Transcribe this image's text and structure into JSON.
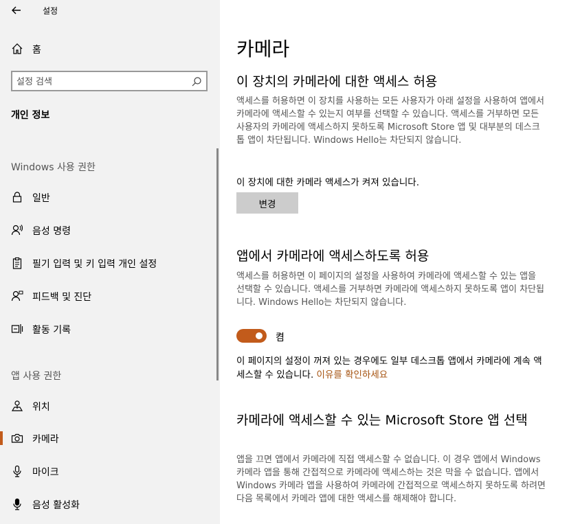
{
  "header": {
    "title": "설정",
    "back_icon": "back-arrow-icon"
  },
  "sidebar": {
    "home_label": "홈",
    "search_placeholder": "설정 검색",
    "section_title": "개인 정보",
    "groups": [
      {
        "title": "Windows 사용 권한",
        "items": [
          {
            "label": "일반",
            "icon": "lock-icon"
          },
          {
            "label": "음성 명령",
            "icon": "speech-icon"
          },
          {
            "label": "필기 입력 및 키 입력 개인 설정",
            "icon": "clipboard-icon"
          },
          {
            "label": "피드백 및 진단",
            "icon": "feedback-icon"
          },
          {
            "label": "활동 기록",
            "icon": "timeline-icon"
          }
        ]
      },
      {
        "title": "앱 사용 권한",
        "items": [
          {
            "label": "위치",
            "icon": "location-icon"
          },
          {
            "label": "카메라",
            "icon": "camera-icon",
            "selected": true
          },
          {
            "label": "마이크",
            "icon": "microphone-icon"
          },
          {
            "label": "음성 활성화",
            "icon": "voice-activation-icon"
          }
        ]
      }
    ]
  },
  "main": {
    "title": "카메라",
    "device_section": {
      "heading": "이 장치의 카메라에 대한 액세스 허용",
      "description": "액세스를 허용하면 이 장치를 사용하는 모든 사용자가 아래 설정을 사용하여 앱에서 카메라에 액세스할 수 있는지 여부를 선택할 수 있습니다. 액세스를 거부하면 모든 사용자의 카메라에 액세스하지 못하도록 Microsoft Store 앱 및 대부분의 데스크톱 앱이 차단됩니다. Windows Hello는 차단되지 않습니다.",
      "status": "이 장치에 대한 카메라 액세스가 켜져 있습니다.",
      "change_button": "변경"
    },
    "app_section": {
      "heading": "앱에서 카메라에 액세스하도록 허용",
      "description": "액세스를 허용하면 이 페이지의 설정을 사용하여 카메라에 액세스할 수 있는 앱을 선택할 수 있습니다. 액세스를 거부하면 카메라에 액세스하지 못하도록 앱이 차단됩니다. Windows Hello는 차단되지 않습니다.",
      "toggle_label": "켬",
      "toggle_on": true,
      "note": "이 페이지의 설정이 꺼져 있는 경우에도 일부 데스크톱 앱에서 카메라에 계속 액세스할 수 있습니다.",
      "link": "이유를 확인하세요"
    },
    "store_section": {
      "heading": "카메라에 액세스할 수 있는 Microsoft Store 앱 선택",
      "description": "앱을 끄면 앱에서 카메라에 직접 액세스할 수 없습니다. 이 경우 앱에서 Windows 카메라 앱을 통해 간접적으로 카메라에 액세스하는 것은 막을 수 없습니다. 앱에서 Windows 카메라 앱을 사용하여 카메라에 간접적으로 액세스하지 못하도록 하려면 다음 목록에서 카메라 앱에 대한 액세스를 해제해야 합니다."
    }
  },
  "colors": {
    "accent": "#c25b1b",
    "link": "#a5520f",
    "sidebar_bg": "#f2f2f2"
  }
}
